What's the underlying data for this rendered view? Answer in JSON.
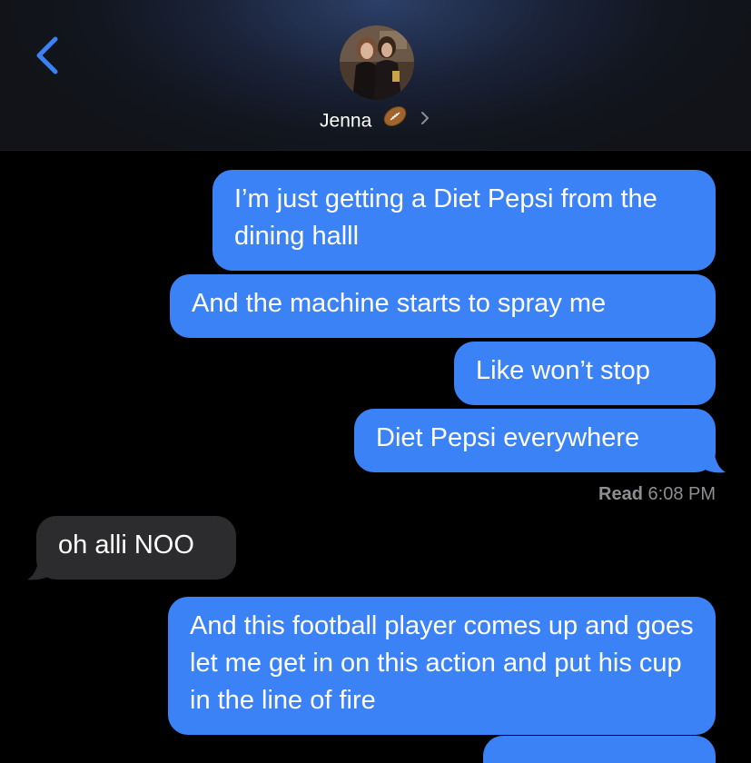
{
  "header": {
    "contact_name": "Jenna",
    "contact_emoji": "american-football-icon",
    "back_icon": "chevron-left-icon",
    "accent": "#3b82f6"
  },
  "messages": [
    {
      "direction": "outgoing",
      "text": "I’m just getting a Diet Pepsi from the dining halll"
    },
    {
      "direction": "outgoing",
      "text": "And the machine starts to spray me"
    },
    {
      "direction": "outgoing",
      "text": "Like won’t stop"
    },
    {
      "direction": "outgoing",
      "text": "Diet Pepsi everywhere"
    },
    {
      "direction": "incoming",
      "text": "oh alli NOO"
    },
    {
      "direction": "outgoing",
      "text": "And this football player comes up and goes let me get in on this action and put his cup in the line of fire"
    }
  ],
  "receipt": {
    "label": "Read",
    "time": "6:08 PM"
  },
  "colors": {
    "outgoing_bubble": "#3b82f6",
    "incoming_bubble": "#2c2c2e",
    "background": "#000000",
    "receipt": "#8e8e93"
  }
}
